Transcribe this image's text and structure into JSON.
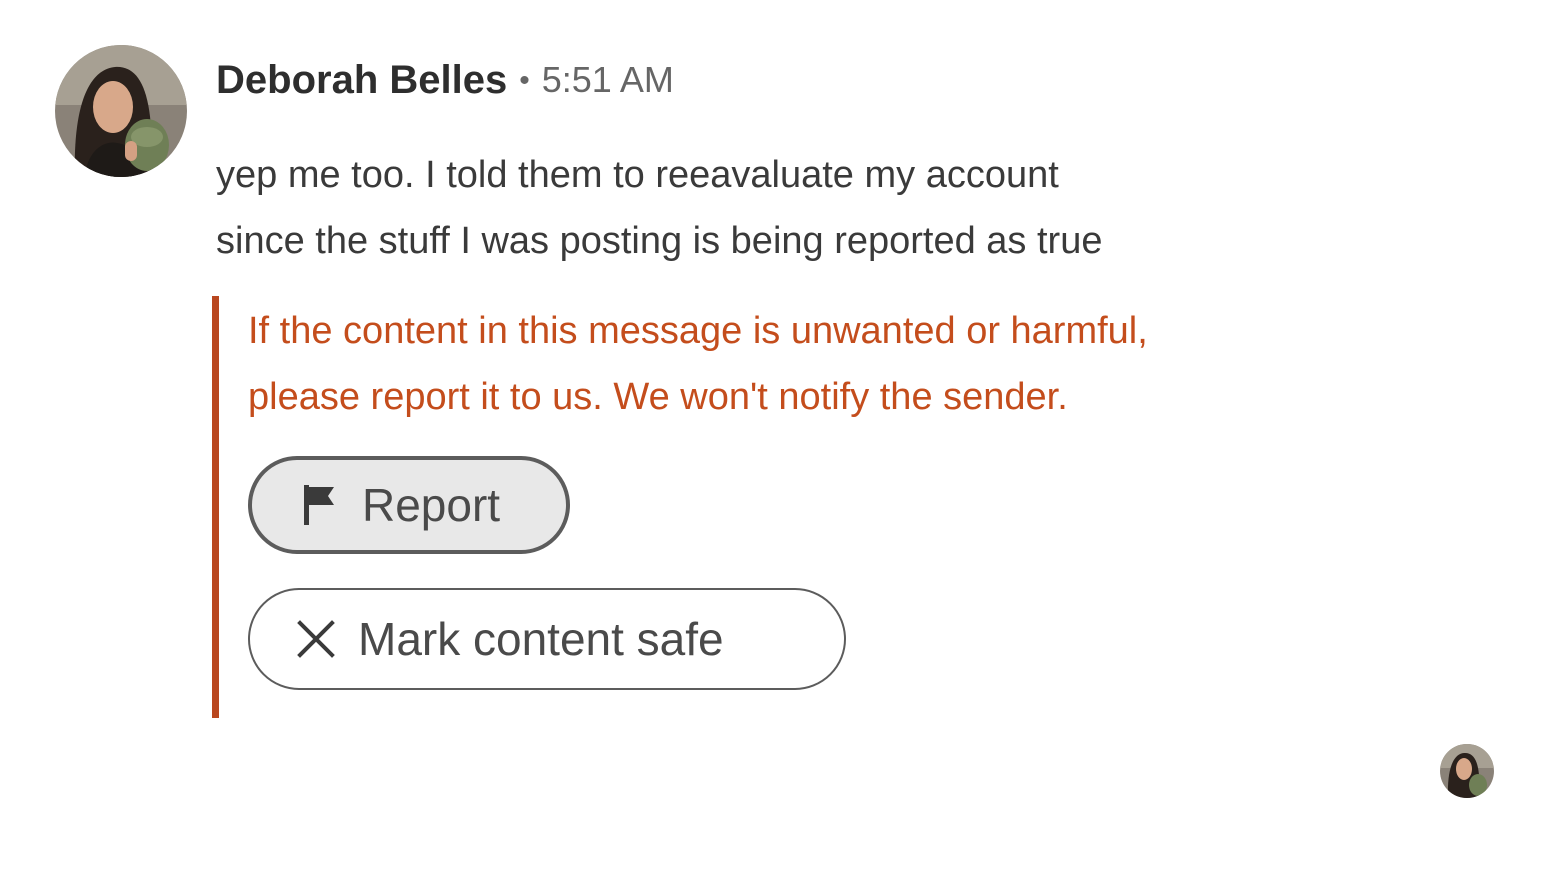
{
  "message": {
    "sender_name": "Deborah Belles",
    "separator": "•",
    "timestamp": "5:51 AM",
    "body_lines": [
      "yep me too.  I told them to reeavaluate my account",
      "since the stuff I was posting is being reported as true"
    ]
  },
  "warning": {
    "lines": [
      "If the content in this message is unwanted or harmful,",
      "please report it to us. We won't notify the sender."
    ],
    "accent_color": "#b9471f",
    "text_color": "#c44d1c"
  },
  "actions": {
    "report_label": "Report",
    "report_icon": "flag-icon",
    "mark_safe_label": "Mark content safe",
    "mark_safe_icon": "close-icon"
  },
  "read_receipt": {
    "icon": "avatar-thumbnail"
  }
}
